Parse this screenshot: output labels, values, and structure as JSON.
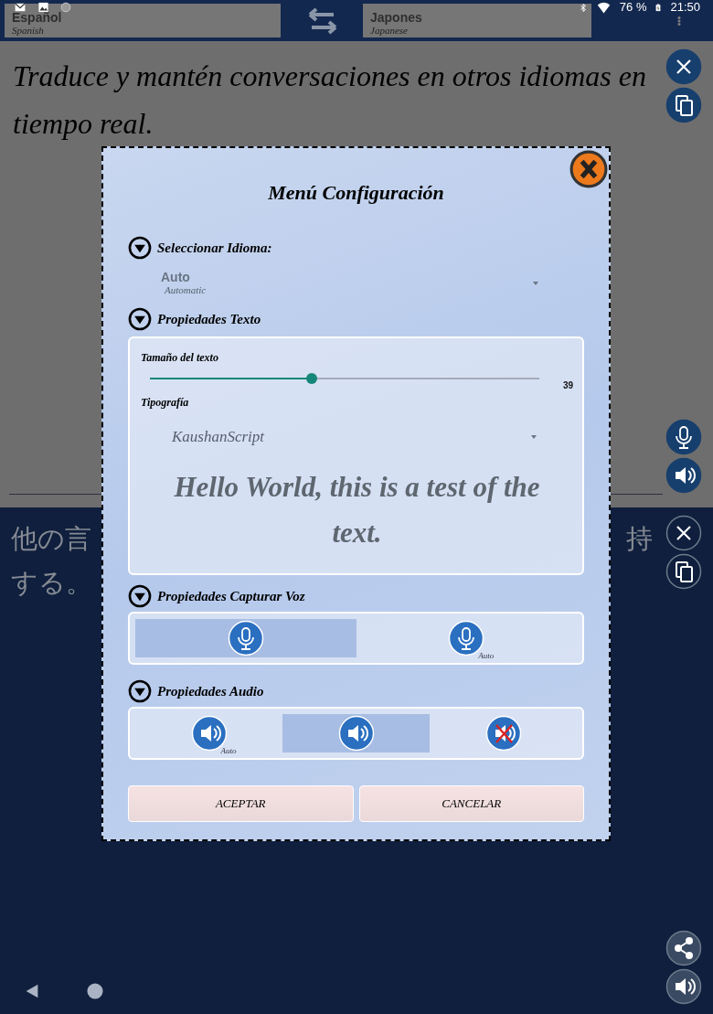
{
  "status_bar": {
    "battery": "76 %",
    "time": "21:50"
  },
  "header": {
    "source_language": {
      "name": "Español",
      "subtitle": "Spanish"
    },
    "target_language": {
      "name": "Japones",
      "subtitle": "Japanese"
    }
  },
  "source_panel": {
    "text": "Traduce y mantén conversaciones en otros idiomas en tiempo real."
  },
  "target_panel": {
    "line_1_start": "他の言",
    "line_1_end": "持",
    "line_2": "する。"
  },
  "dialog": {
    "title": "Menú Configuración",
    "language_section": {
      "heading": "Seleccionar Idioma:",
      "value": "Auto",
      "value_subtitle": "Automatic"
    },
    "text_section": {
      "heading": "Propiedades Texto",
      "size_label": "Tamaño del texto",
      "size": {
        "level": 0.415
      },
      "size_value": "39",
      "font_label": "Tipografía",
      "font_value": "KaushanScript",
      "preview": "Hello World, this is a test of the text."
    },
    "voice_section": {
      "heading": "Propiedades Capturar Voz",
      "options": [
        {
          "kind": "mic",
          "selected": true
        },
        {
          "kind": "mic",
          "badge": "Auto",
          "selected": false
        }
      ]
    },
    "audio_section": {
      "heading": "Propiedades Audio",
      "options": [
        {
          "kind": "speaker",
          "badge": "Auto",
          "selected": false
        },
        {
          "kind": "speaker",
          "selected": true
        },
        {
          "kind": "muted",
          "selected": false
        }
      ]
    },
    "buttons": [
      "ACEPTAR",
      "CANCELAR"
    ]
  }
}
